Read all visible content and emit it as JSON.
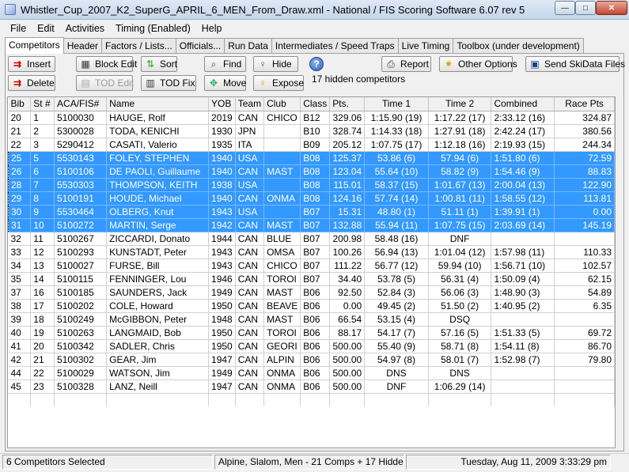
{
  "window": {
    "title": "Whistler_Cup_2007_K2_SuperG_APRIL_6_MEN_From_Draw.xml - National / FIS Scoring Software 6.07 rev 5",
    "minimize": "—",
    "maximize": "□",
    "close": "✕"
  },
  "menu": [
    "File",
    "Edit",
    "Activities",
    "Timing (Enabled)",
    "Help"
  ],
  "tabs": [
    "Competitors",
    "Header",
    "Factors / Lists...",
    "Officials...",
    "Run Data",
    "Intermediates / Speed Traps",
    "Live Timing",
    "Toolbox (under development)"
  ],
  "toolbar": {
    "insert": "Insert",
    "delete": "Delete",
    "block_edit": "Block Edit",
    "tod_edit": "TOD Edit",
    "sort": "Sort",
    "tod_fix": "TOD Fix",
    "find": "Find",
    "move": "Move",
    "hide": "Hide",
    "expose": "Expose",
    "help": "?",
    "hidden_note": "17 hidden competitors",
    "report": "Report",
    "other_options": "Other Options",
    "send_skidata": "Send SkiData Files"
  },
  "icons": {
    "insert": "insert-row-icon",
    "delete": "delete-row-icon",
    "block_edit": "block-edit-icon",
    "tod_edit": "tod-edit-icon",
    "sort": "sort-icon",
    "tod_fix": "tod-fix-icon",
    "find": "find-icon",
    "move": "move-icon",
    "hide": "hide-icon",
    "expose": "expose-icon",
    "report": "printer-icon",
    "other_options": "options-star-icon",
    "send_skidata": "send-skidata-icon"
  },
  "colors": {
    "selection": "#3399ff"
  },
  "table": {
    "columns": [
      "Bib",
      "St #",
      "ACA/FIS#",
      "Name",
      "YOB",
      "Team",
      "Club",
      "Class",
      "Pts.",
      "Time 1",
      "Time 2",
      "Combined",
      "Race Pts"
    ],
    "rows": [
      {
        "sel": false,
        "cells": [
          "20",
          "1",
          "5100030",
          "HAUGE, Rolf",
          "2019",
          "CAN",
          "CHICO",
          "B12",
          "329.06",
          "1:15.90 (19)",
          "1:17.22 (17)",
          "2:33.12 (16)",
          "324.87"
        ]
      },
      {
        "sel": false,
        "cells": [
          "21",
          "2",
          "5300028",
          "TODA,  KENICHI",
          "1930",
          "JPN",
          "",
          "B10",
          "328.74",
          "1:14.33 (18)",
          "1:27.91 (18)",
          "2:42.24 (17)",
          "380.56"
        ]
      },
      {
        "sel": false,
        "cells": [
          "22",
          "3",
          "5290412",
          "CASATI, Valerio",
          "1935",
          "ITA",
          "",
          "B09",
          "205.12",
          "1:07.75 (17)",
          "1:12.18 (16)",
          "2:19.93 (15)",
          "244.34"
        ]
      },
      {
        "sel": true,
        "cells": [
          "25",
          "5",
          "5530143",
          "FOLEY, STEPHEN",
          "1940",
          "USA",
          "",
          "B08",
          "125.37",
          "53.86 (6)",
          "57.94 (6)",
          "1:51.80 (6)",
          "72.59"
        ]
      },
      {
        "sel": true,
        "cells": [
          "26",
          "6",
          "5100106",
          "DE PAOLI, Guillaume",
          "1940",
          "CAN",
          "MAST",
          "B08",
          "123.04",
          "55.64 (10)",
          "58.82 (9)",
          "1:54.46 (9)",
          "88.83"
        ]
      },
      {
        "sel": true,
        "cells": [
          "28",
          "7",
          "5530303",
          "THOMPSON, KEITH",
          "1938",
          "USA",
          "",
          "B08",
          "115.01",
          "58.37 (15)",
          "1:01.67 (13)",
          "2:00.04 (13)",
          "122.90"
        ]
      },
      {
        "sel": true,
        "cells": [
          "29",
          "8",
          "5100191",
          "HOUDE, Michael",
          "1940",
          "CAN",
          "ONMA",
          "B08",
          "124.16",
          "57.74 (14)",
          "1:00.81 (11)",
          "1:58.55 (12)",
          "113.81"
        ]
      },
      {
        "sel": true,
        "cells": [
          "30",
          "9",
          "5530464",
          "OLBERG, Knut",
          "1943",
          "USA",
          "",
          "B07",
          "15.31",
          "48.80 (1)",
          "51.11 (1)",
          "1:39.91 (1)",
          "0.00"
        ]
      },
      {
        "sel": true,
        "cells": [
          "31",
          "10",
          "5100272",
          "MARTIN, Serge",
          "1942",
          "CAN",
          "MAST",
          "B07",
          "132.88",
          "55.94 (11)",
          "1:07.75 (15)",
          "2:03.69 (14)",
          "145.19"
        ]
      },
      {
        "sel": false,
        "cells": [
          "32",
          "11",
          "5100267",
          "ZICCARDI, Donato",
          "1944",
          "CAN",
          "BLUE",
          "B07",
          "200.98",
          "58.48 (16)",
          "DNF",
          "",
          ""
        ]
      },
      {
        "sel": false,
        "cells": [
          "33",
          "12",
          "5100293",
          "KUNSTADT, Peter",
          "1943",
          "CAN",
          "OMSA",
          "B07",
          "100.26",
          "56.94 (13)",
          "1:01.04 (12)",
          "1:57.98 (11)",
          "110.33"
        ]
      },
      {
        "sel": false,
        "cells": [
          "34",
          "13",
          "5100027",
          "FURSE, Bill",
          "1943",
          "CAN",
          "CHICO",
          "B07",
          "111.22",
          "56.77 (12)",
          "59.94 (10)",
          "1:56.71 (10)",
          "102.57"
        ]
      },
      {
        "sel": false,
        "cells": [
          "35",
          "14",
          "5100115",
          "FENNINGER, Lou",
          "1946",
          "CAN",
          "TOROI",
          "B07",
          "34.40",
          "53.78 (5)",
          "56.31 (4)",
          "1:50.09 (4)",
          "62.15"
        ]
      },
      {
        "sel": false,
        "cells": [
          "37",
          "16",
          "5100185",
          "SAUNDERS, Jack",
          "1949",
          "CAN",
          "MAST",
          "B06",
          "92.50",
          "52.84 (3)",
          "56.06 (3)",
          "1:48.90 (3)",
          "54.89"
        ]
      },
      {
        "sel": false,
        "cells": [
          "38",
          "17",
          "5100202",
          "COLE, Howard",
          "1950",
          "CAN",
          "BEAVE",
          "B06",
          "0.00",
          "49.45 (2)",
          "51.50 (2)",
          "1:40.95 (2)",
          "6.35"
        ]
      },
      {
        "sel": false,
        "cells": [
          "39",
          "18",
          "5100249",
          "McGIBBON, Peter",
          "1948",
          "CAN",
          "MAST",
          "B06",
          "66.54",
          "53.15 (4)",
          "DSQ",
          "",
          ""
        ]
      },
      {
        "sel": false,
        "cells": [
          "40",
          "19",
          "5100263",
          "LANGMAID, Bob",
          "1950",
          "CAN",
          "TOROI",
          "B06",
          "88.17",
          "54.17 (7)",
          "57.16 (5)",
          "1:51.33 (5)",
          "69.72"
        ]
      },
      {
        "sel": false,
        "cells": [
          "41",
          "20",
          "5100342",
          "SADLER, Chris",
          "1950",
          "CAN",
          "GEORI",
          "B06",
          "500.00",
          "55.40 (9)",
          "58.71 (8)",
          "1:54.11 (8)",
          "86.70"
        ]
      },
      {
        "sel": false,
        "cells": [
          "42",
          "21",
          "5100302",
          "GEAR, Jim",
          "1947",
          "CAN",
          "ALPIN",
          "B06",
          "500.00",
          "54.97 (8)",
          "58.01 (7)",
          "1:52.98 (7)",
          "79.80"
        ]
      },
      {
        "sel": false,
        "cells": [
          "44",
          "22",
          "5100029",
          "WATSON, Jim",
          "1949",
          "CAN",
          "ONMA",
          "B06",
          "500.00",
          "DNS",
          "DNS",
          "",
          ""
        ]
      },
      {
        "sel": false,
        "cells": [
          "45",
          "23",
          "5100328",
          "LANZ, Neill",
          "1947",
          "CAN",
          "ONMA",
          "B06",
          "500.00",
          "DNF",
          "1:06.29 (14)",
          "",
          ""
        ]
      }
    ]
  },
  "status": {
    "selected": "6 Competitors Selected",
    "summary": "Alpine, Slalom, Men - 21 Comps + 17 Hidden",
    "datetime": "Tuesday, Aug 11, 2009  3:33:29 pm"
  }
}
